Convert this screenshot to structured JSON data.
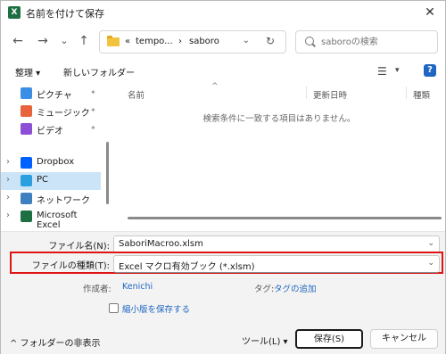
{
  "window": {
    "app_icon": "X",
    "title": "名前を付けて保存",
    "close_glyph": "✕"
  },
  "nav": {
    "back_glyph": "←",
    "forward_glyph": "→",
    "recent_glyph": "⌄",
    "up_glyph": "↑",
    "address_prefix": "«",
    "address_segment_1": "tempo...",
    "address_sep": "›",
    "address_segment_2": "saboro",
    "dropdown_glyph": "⌄",
    "refresh_glyph": "↻",
    "search_placeholder": "saboroの検索"
  },
  "toolbar": {
    "organize": "整理 ▾",
    "new_folder": "新しいフォルダー",
    "view_glyph": "☰",
    "view_drop": "▾",
    "help": "?"
  },
  "sidebar": {
    "items": [
      {
        "label": "ピクチャ",
        "icon": "pictures-icon",
        "color": "#3a8ee6",
        "pinned": true,
        "chevron": ""
      },
      {
        "label": "ミュージック",
        "icon": "music-icon",
        "color": "#e8623d",
        "pinned": true,
        "chevron": ""
      },
      {
        "label": "ビデオ",
        "icon": "video-icon",
        "color": "#8c4fd6",
        "pinned": true,
        "chevron": ""
      },
      {
        "label": "Dropbox",
        "icon": "dropbox-icon",
        "color": "#0061fe",
        "pinned": false,
        "chevron": "›"
      },
      {
        "label": "PC",
        "icon": "pc-icon",
        "color": "#2b9fe0",
        "pinned": false,
        "chevron": "›"
      },
      {
        "label": "ネットワーク",
        "icon": "network-icon",
        "color": "#3f7fbf",
        "pinned": false,
        "chevron": "›"
      },
      {
        "label": "Microsoft Excel",
        "icon": "excel-icon",
        "color": "#1d6f42",
        "pinned": false,
        "chevron": "›"
      }
    ],
    "pin_glyph": "📌"
  },
  "content": {
    "col_name": "名前",
    "col_date": "更新日時",
    "col_type": "種類",
    "sort_glyph": "^",
    "empty_message": "検索条件に一致する項目はありません。"
  },
  "footer": {
    "filename_label": "ファイル名(N):",
    "filename_value": "SaboriMacroo.xlsm",
    "filetype_label": "ファイルの種類(T):",
    "filetype_value": "Excel マクロ有効ブック (*.xlsm)",
    "author_label": "作成者:",
    "author_value": "Kenichi",
    "tags_label": "タグ:",
    "tags_value": "タグの追加",
    "thumbnail_label": "縮小版を保存する",
    "hide_folders": "^ フォルダーの非表示",
    "tools": "ツール(L)  ▾",
    "save": "保存(S)",
    "cancel": "キャンセル"
  },
  "colors": {
    "highlight_red": "#e01414",
    "selected_bg": "#cce4f7",
    "link_blue": "#1f66c2"
  }
}
